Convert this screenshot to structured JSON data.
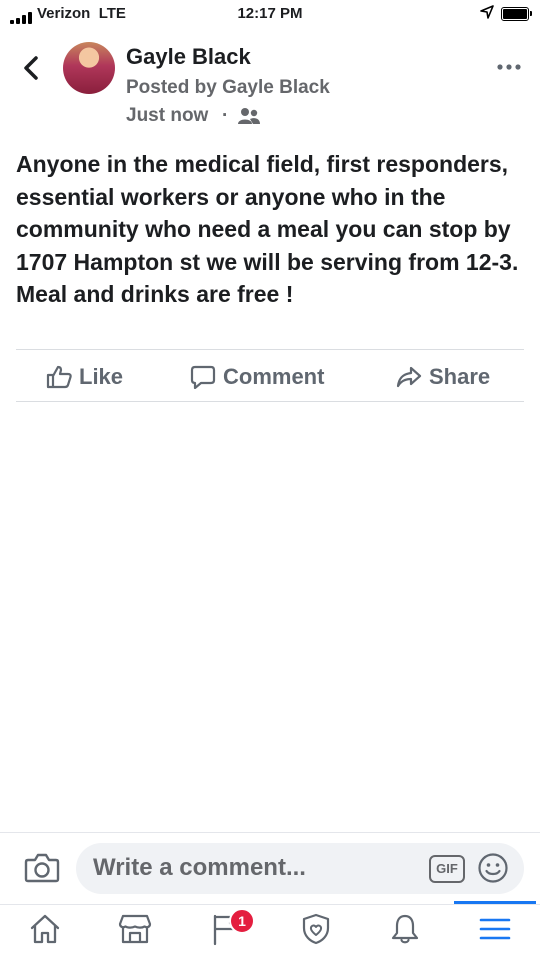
{
  "status_bar": {
    "carrier": "Verizon",
    "network": "LTE",
    "time": "12:17 PM"
  },
  "post": {
    "author": "Gayle Black",
    "posted_by": "Posted by Gayle Black",
    "time": "Just now",
    "separator": "·",
    "audience_icon": "group-icon",
    "text": "Anyone in the medical field, first responders, essential workers or anyone who in the community who need a meal you can stop by 1707 Hampton st we will be serving from 12-3. Meal and drinks are free !"
  },
  "actions": {
    "like": "Like",
    "comment": "Comment",
    "share": "Share"
  },
  "comment_bar": {
    "placeholder": "Write a comment...",
    "gif": "GIF"
  },
  "nav": {
    "items": [
      "home-icon",
      "marketplace-icon",
      "pages-icon",
      "shield-heart-icon",
      "bell-icon",
      "menu-icon"
    ],
    "badge": "1",
    "active": "menu-icon"
  },
  "colors": {
    "accent": "#1877f2",
    "badge": "#e41e3f",
    "secondary_text": "#65676b"
  }
}
